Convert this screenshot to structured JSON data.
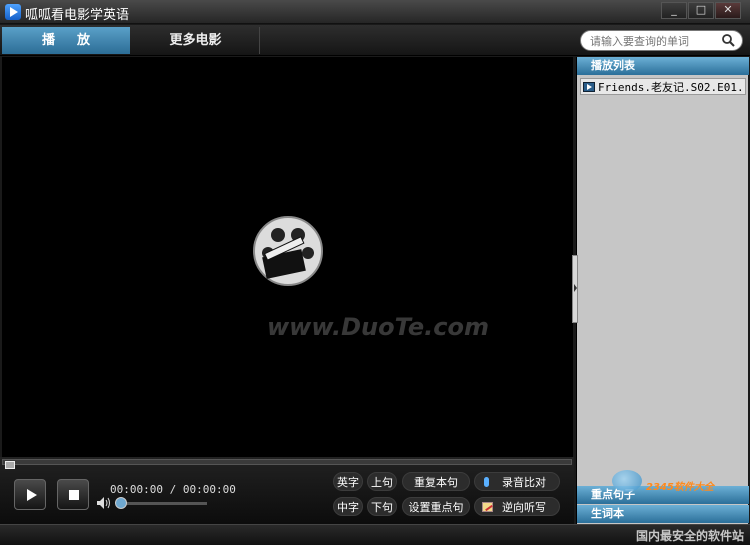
{
  "window": {
    "title": "呱呱看电影学英语",
    "min_label": "_",
    "max_label": "□",
    "close_label": "✕"
  },
  "tabs": {
    "play_label": "播放",
    "more_movies_label": "更多电影"
  },
  "search": {
    "placeholder": "请输入要查询的单词"
  },
  "video": {
    "watermark": "www.DuoTe.com"
  },
  "panel": {
    "playlist_label": "播放列表",
    "playlist_items": [
      "Friends.老友记.S02.E01..."
    ],
    "key_sentences_label": "重点句子",
    "vocabulary_label": "生词本",
    "brand_text": "2345软件大全",
    "site_text": "国内最安全的软件站"
  },
  "controls": {
    "time_display": "00:00:00 / 00:00:00",
    "buttons": {
      "english_subs": "英字",
      "prev_sentence": "上句",
      "repeat_sentence": "重复本句",
      "record_compare": "录音比对",
      "chinese_subs": "中字",
      "next_sentence": "下句",
      "set_key_sentence": "设置重点句",
      "reverse_dictation": "逆向听写"
    },
    "progress": 0.0,
    "volume": 0.0
  },
  "colors": {
    "accent": "#3a86b5",
    "panel_bg": "#c6c6c6"
  }
}
